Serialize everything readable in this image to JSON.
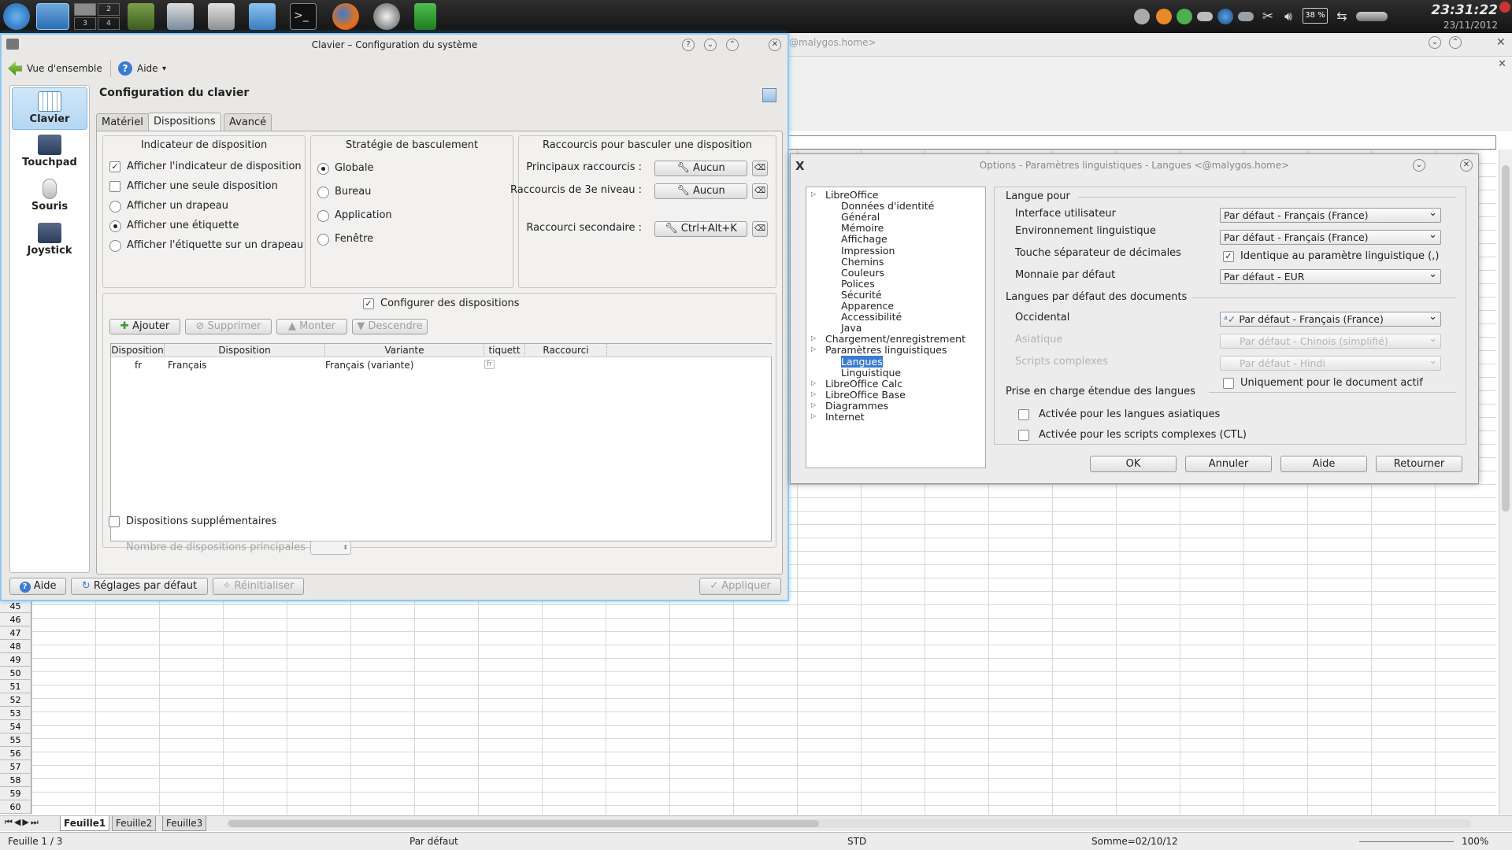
{
  "taskbar": {
    "desktops": [
      "2",
      "3",
      "4"
    ],
    "clock": "23:31:22",
    "date": "23/11/2012",
    "battery": "38 %"
  },
  "calc": {
    "title_fragment": "@malygos.home>",
    "rows": [
      "45",
      "46",
      "47",
      "48",
      "49",
      "50",
      "51",
      "52",
      "53",
      "54",
      "55",
      "56",
      "57",
      "58",
      "59",
      "60"
    ],
    "sheets": [
      "Feuille1",
      "Feuille2",
      "Feuille3"
    ],
    "status": {
      "sheet": "Feuille 1 / 3",
      "style": "Par défaut",
      "mode": "STD",
      "sum": "Somme=02/10/12",
      "zoom": "100%"
    }
  },
  "kde": {
    "title": "Clavier – Configuration du système",
    "back_label": "Vue d'ensemble",
    "help_label": "Aide",
    "sidebar": [
      {
        "label": "Clavier"
      },
      {
        "label": "Touchpad"
      },
      {
        "label": "Souris"
      },
      {
        "label": "Joystick"
      }
    ],
    "page_title": "Configuration du clavier",
    "tabs": [
      "Matériel",
      "Dispositions",
      "Avancé"
    ],
    "indicator": {
      "heading": "Indicateur de disposition",
      "options": [
        "Afficher l'indicateur de disposition",
        "Afficher une seule disposition",
        "Afficher un drapeau",
        "Afficher une étiquette",
        "Afficher l'étiquette sur un drapeau"
      ]
    },
    "strategy": {
      "heading": "Stratégie de basculement",
      "options": [
        "Globale",
        "Bureau",
        "Application",
        "Fenêtre"
      ]
    },
    "shortcuts": {
      "heading": "Raccourcis pour basculer une disposition",
      "main_label": "Principaux raccourcis :",
      "main_value": "Aucun",
      "level3_label": "Raccourcis de 3e niveau :",
      "level3_value": "Aucun",
      "secondary_label": "Raccourci secondaire :",
      "secondary_value": "Ctrl+Alt+K"
    },
    "configure_label": "Configurer des dispositions",
    "buttons": {
      "add": "Ajouter",
      "remove": "Supprimer",
      "up": "Monter",
      "down": "Descendre"
    },
    "table": {
      "headers": [
        "Disposition",
        "Disposition",
        "Variante",
        "tiquett",
        "Raccourci"
      ],
      "rows": [
        {
          "code": "fr",
          "layout": "Français",
          "variant": "Français (variante)",
          "label": "fr",
          "shortcut": ""
        }
      ]
    },
    "extra_label": "Dispositions supplémentaires",
    "main_count_label": "Nombre de dispositions principales :",
    "footer": {
      "help": "Aide",
      "defaults": "Réglages par défaut",
      "reset": "Réinitialiser",
      "apply": "Appliquer"
    }
  },
  "lo": {
    "title": "Options - Paramètres linguistiques - Langues <@malygos.home>",
    "tree": [
      {
        "label": "LibreOffice",
        "level": 0
      },
      {
        "label": "Données d'identité",
        "level": 1
      },
      {
        "label": "Général",
        "level": 1
      },
      {
        "label": "Mémoire",
        "level": 1
      },
      {
        "label": "Affichage",
        "level": 1
      },
      {
        "label": "Impression",
        "level": 1
      },
      {
        "label": "Chemins",
        "level": 1
      },
      {
        "label": "Couleurs",
        "level": 1
      },
      {
        "label": "Polices",
        "level": 1
      },
      {
        "label": "Sécurité",
        "level": 1
      },
      {
        "label": "Apparence",
        "level": 1
      },
      {
        "label": "Accessibilité",
        "level": 1
      },
      {
        "label": "Java",
        "level": 1
      },
      {
        "label": "Chargement/enregistrement",
        "level": 0
      },
      {
        "label": "Paramètres linguistiques",
        "level": 0
      },
      {
        "label": "Langues",
        "level": 1,
        "selected": true
      },
      {
        "label": "Linguistique",
        "level": 1
      },
      {
        "label": "LibreOffice Calc",
        "level": 0
      },
      {
        "label": "LibreOffice Base",
        "level": 0
      },
      {
        "label": "Diagrammes",
        "level": 0
      },
      {
        "label": "Internet",
        "level": 0
      }
    ],
    "lang_for": "Langue pour",
    "ui_label": "Interface utilisateur",
    "ui_value": "Par défaut - Français (France)",
    "locale_label": "Environnement linguistique",
    "locale_value": "Par défaut - Français (France)",
    "decimal_label": "Touche séparateur de décimales",
    "decimal_value": "Identique au paramètre linguistique (,)",
    "currency_label": "Monnaie par défaut",
    "currency_value": "Par défaut - EUR",
    "doc_langs": "Langues par défaut des documents",
    "western_label": "Occidental",
    "western_value": "Par défaut - Français (France)",
    "asian_label": "Asiatique",
    "asian_value": "Par défaut - Chinois (simplifié)",
    "ctl_label": "Scripts complexes",
    "ctl_value": "Par défaut - Hindi",
    "only_doc": "Uniquement pour le document actif",
    "extended": "Prise en charge étendue des langues",
    "asian_enable": "Activée pour les langues asiatiques",
    "ctl_enable": "Activée pour les scripts complexes (CTL)",
    "buttons": {
      "ok": "OK",
      "cancel": "Annuler",
      "help": "Aide",
      "back": "Retourner"
    }
  }
}
